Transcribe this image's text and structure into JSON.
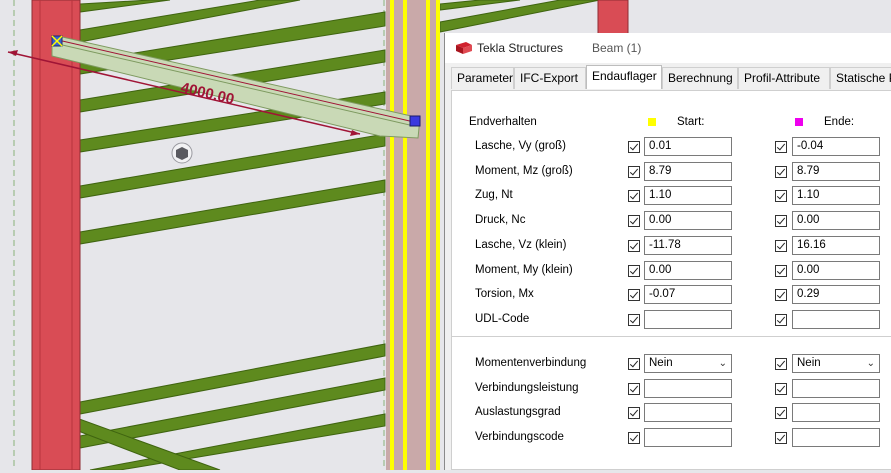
{
  "viewport": {
    "dimension_text": "4000.00",
    "colors": {
      "background": "#e6e6ea",
      "column": "#d94c55",
      "beam": "#5e8a1e",
      "yellow_line": "#ffff00",
      "selection": "#a01436",
      "selected_beam": "#c9d9b6"
    }
  },
  "window": {
    "app_title": "Tekla Structures",
    "subtitle": "Beam (1)"
  },
  "tabs": [
    {
      "label": "Parameter",
      "active": false
    },
    {
      "label": "IFC-Export",
      "active": false
    },
    {
      "label": "Endauflager",
      "active": true
    },
    {
      "label": "Berechnung",
      "active": false
    },
    {
      "label": "Profil-Attribute",
      "active": false
    },
    {
      "label": "Statische P",
      "active": false
    }
  ],
  "endauflager": {
    "section_label": "Endverhalten",
    "start_header": "Start:",
    "end_header": "Ende:",
    "start_color": "#ffff00",
    "end_color": "#ee00ee",
    "rows": [
      {
        "label": "Lasche, Vy (groß)",
        "start_checked": true,
        "start": "0.01",
        "end_checked": true,
        "end": "-0.04"
      },
      {
        "label": "Moment, Mz (groß)",
        "start_checked": true,
        "start": "8.79",
        "end_checked": true,
        "end": "8.79"
      },
      {
        "label": "Zug, Nt",
        "start_checked": true,
        "start": "1.10",
        "end_checked": true,
        "end": "1.10"
      },
      {
        "label": "Druck, Nc",
        "start_checked": true,
        "start": "0.00",
        "end_checked": true,
        "end": "0.00"
      },
      {
        "label": "Lasche, Vz (klein)",
        "start_checked": true,
        "start": "-11.78",
        "end_checked": true,
        "end": "16.16"
      },
      {
        "label": "Moment, My (klein)",
        "start_checked": true,
        "start": "0.00",
        "end_checked": true,
        "end": "0.00"
      },
      {
        "label": "Torsion, Mx",
        "start_checked": true,
        "start": "-0.07",
        "end_checked": true,
        "end": "0.29"
      },
      {
        "label": "UDL-Code",
        "start_checked": true,
        "start": "",
        "end_checked": true,
        "end": ""
      }
    ],
    "connection_rows": [
      {
        "label": "Momentenverbindung",
        "start_checked": true,
        "start": "Nein",
        "end_checked": true,
        "end": "Nein",
        "dropdown": true
      },
      {
        "label": "Verbindungsleistung",
        "start_checked": true,
        "start": "",
        "end_checked": true,
        "end": "",
        "dropdown": false
      },
      {
        "label": "Auslastungsgrad",
        "start_checked": true,
        "start": "",
        "end_checked": true,
        "end": "",
        "dropdown": false
      },
      {
        "label": "Verbindungscode",
        "start_checked": true,
        "start": "",
        "end_checked": true,
        "end": "",
        "dropdown": false
      }
    ]
  }
}
